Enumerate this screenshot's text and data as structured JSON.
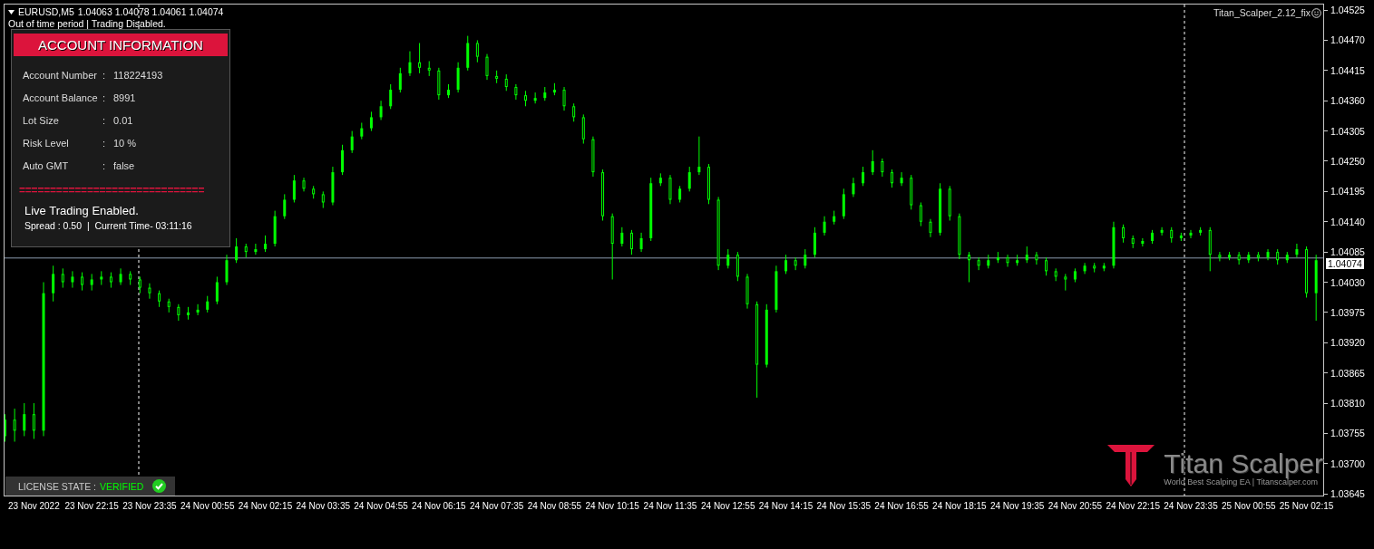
{
  "chart": {
    "symbol": "EURUSD,M5",
    "ohlc": "1.04063 1.04078 1.04061 1.04074",
    "status": "Out of time period | Trading Disabled.",
    "expert": "Titan_Scalper_2.12_fix",
    "current_price": "1.04074"
  },
  "panel": {
    "title": "ACCOUNT INFORMATION",
    "rows": [
      {
        "label": "Account Number",
        "colon": ":",
        "value": "118224193"
      },
      {
        "label": "Account Balance",
        "colon": ":",
        "value": "8991"
      },
      {
        "label": "Lot Size",
        "colon": ":",
        "value": "0.01"
      },
      {
        "label": "Risk Level",
        "colon": ":",
        "value": "10 %"
      },
      {
        "label": "Auto GMT",
        "colon": ":",
        "value": "false"
      }
    ],
    "separator": "==============================",
    "live_status": "Live Trading Enabled.",
    "info_line": "Spread : 0.50  |  Current Time- 03:11:16"
  },
  "license": {
    "label": "LICENSE STATE :",
    "state": "VERIFIED",
    "verified": true
  },
  "logo": {
    "name": "Titan Scalper",
    "tagline": "World Best Scalping EA | Titanscalper.com"
  },
  "chart_data": {
    "type": "candlestick",
    "ylim": [
      1.03642,
      1.04535
    ],
    "ref_lines": [
      {
        "axis": "y",
        "value": 1.04074
      }
    ],
    "yticks": [
      {
        "value": 1.04525,
        "label": "1.04525"
      },
      {
        "value": 1.0447,
        "label": "1.04470"
      },
      {
        "value": 1.04415,
        "label": "1.04415"
      },
      {
        "value": 1.0436,
        "label": "1.04360"
      },
      {
        "value": 1.04305,
        "label": "1.04305"
      },
      {
        "value": 1.0425,
        "label": "1.04250"
      },
      {
        "value": 1.04195,
        "label": "1.04195"
      },
      {
        "value": 1.0414,
        "label": "1.04140"
      },
      {
        "value": 1.04085,
        "label": "1.04085"
      },
      {
        "value": 1.0403,
        "label": "1.04030"
      },
      {
        "value": 1.03975,
        "label": "1.03975"
      },
      {
        "value": 1.0392,
        "label": "1.03920"
      },
      {
        "value": 1.03865,
        "label": "1.03865"
      },
      {
        "value": 1.0381,
        "label": "1.03810"
      },
      {
        "value": 1.03755,
        "label": "1.03755"
      },
      {
        "value": 1.037,
        "label": "1.03700"
      },
      {
        "value": 1.03645,
        "label": "1.03645"
      }
    ],
    "categories": [
      null,
      null,
      null,
      "23 Nov 2022",
      null,
      null,
      null,
      null,
      null,
      "23 Nov 22:15",
      null,
      null,
      null,
      null,
      null,
      "23 Nov 23:35",
      null,
      null,
      null,
      null,
      null,
      "24 Nov 00:55",
      null,
      null,
      null,
      null,
      null,
      "24 Nov 02:15",
      null,
      null,
      null,
      null,
      null,
      "24 Nov 03:35",
      null,
      null,
      null,
      null,
      null,
      "24 Nov 04:55",
      null,
      null,
      null,
      null,
      null,
      "24 Nov 06:15",
      null,
      null,
      null,
      null,
      null,
      "24 Nov 07:35",
      null,
      null,
      null,
      null,
      null,
      "24 Nov 08:55",
      null,
      null,
      null,
      null,
      null,
      "24 Nov 10:15",
      null,
      null,
      null,
      null,
      null,
      "24 Nov 11:35",
      null,
      null,
      null,
      null,
      null,
      "24 Nov 12:55",
      null,
      null,
      null,
      null,
      null,
      "24 Nov 14:15",
      null,
      null,
      null,
      null,
      null,
      "24 Nov 15:35",
      null,
      null,
      null,
      null,
      null,
      "24 Nov 16:55",
      null,
      null,
      null,
      null,
      null,
      "24 Nov 18:15",
      null,
      null,
      null,
      null,
      null,
      "24 Nov 19:35",
      null,
      null,
      null,
      null,
      null,
      "24 Nov 20:55",
      null,
      null,
      null,
      null,
      null,
      "24 Nov 22:15",
      null,
      null,
      null,
      null,
      null,
      "24 Nov 23:35",
      null,
      null,
      null,
      null,
      null,
      "25 Nov 00:55",
      null,
      null,
      null,
      null,
      null,
      "25 Nov 02:15",
      null
    ],
    "ohlc": [
      [
        1.0375,
        1.0379,
        1.0374,
        1.0378
      ],
      [
        1.0378,
        1.038,
        1.0374,
        1.0376
      ],
      [
        1.0376,
        1.0381,
        1.0375,
        1.0379
      ],
      [
        1.0379,
        1.0381,
        1.03745,
        1.0376
      ],
      [
        1.0376,
        1.0403,
        1.0375,
        1.0401
      ],
      [
        1.0401,
        1.0406,
        1.03995,
        1.04045
      ],
      [
        1.04045,
        1.04055,
        1.0402,
        1.0403
      ],
      [
        1.0403,
        1.0405,
        1.0402,
        1.0404
      ],
      [
        1.0404,
        1.04048,
        1.04015,
        1.04025
      ],
      [
        1.04025,
        1.04045,
        1.04015,
        1.04035
      ],
      [
        1.04035,
        1.0405,
        1.04025,
        1.0404
      ],
      [
        1.0404,
        1.04048,
        1.0402,
        1.0403
      ],
      [
        1.0403,
        1.04055,
        1.04025,
        1.04045
      ],
      [
        1.04045,
        1.0405,
        1.04025,
        1.04035
      ],
      [
        1.04035,
        1.0404,
        1.0401,
        1.0402
      ],
      [
        1.0402,
        1.04028,
        1.04,
        1.0401
      ],
      [
        1.0401,
        1.04015,
        1.03985,
        1.03995
      ],
      [
        1.03995,
        1.04,
        1.03975,
        1.03985
      ],
      [
        1.03985,
        1.0399,
        1.0396,
        1.0397
      ],
      [
        1.0397,
        1.03985,
        1.03962,
        1.03975
      ],
      [
        1.03975,
        1.0399,
        1.0397,
        1.0398
      ],
      [
        1.0398,
        1.04005,
        1.03975,
        1.03995
      ],
      [
        1.03995,
        1.0404,
        1.0399,
        1.0403
      ],
      [
        1.0403,
        1.0408,
        1.04025,
        1.0407
      ],
      [
        1.0407,
        1.0411,
        1.04065,
        1.04095
      ],
      [
        1.04095,
        1.041,
        1.04075,
        1.04085
      ],
      [
        1.04085,
        1.041,
        1.0408,
        1.0409
      ],
      [
        1.0409,
        1.04115,
        1.04085,
        1.041
      ],
      [
        1.041,
        1.0416,
        1.04095,
        1.0415
      ],
      [
        1.0415,
        1.0419,
        1.04145,
        1.0418
      ],
      [
        1.0418,
        1.04225,
        1.04175,
        1.04215
      ],
      [
        1.04215,
        1.0422,
        1.04195,
        1.042
      ],
      [
        1.042,
        1.04205,
        1.04182,
        1.0419
      ],
      [
        1.0419,
        1.04195,
        1.04165,
        1.04175
      ],
      [
        1.04175,
        1.0424,
        1.0417,
        1.0423
      ],
      [
        1.0423,
        1.0428,
        1.04225,
        1.0427
      ],
      [
        1.0427,
        1.04305,
        1.04265,
        1.04295
      ],
      [
        1.04295,
        1.0432,
        1.0429,
        1.0431
      ],
      [
        1.0431,
        1.0434,
        1.04305,
        1.0433
      ],
      [
        1.0433,
        1.0436,
        1.04325,
        1.0435
      ],
      [
        1.0435,
        1.0439,
        1.04345,
        1.0438
      ],
      [
        1.0438,
        1.0442,
        1.04375,
        1.0441
      ],
      [
        1.0441,
        1.0445,
        1.04405,
        1.0443
      ],
      [
        1.0443,
        1.04465,
        1.0441,
        1.0442
      ],
      [
        1.0442,
        1.04432,
        1.04405,
        1.04415
      ],
      [
        1.04415,
        1.0442,
        1.04362,
        1.0437
      ],
      [
        1.0437,
        1.0439,
        1.04365,
        1.0438
      ],
      [
        1.0438,
        1.0443,
        1.04375,
        1.0442
      ],
      [
        1.0442,
        1.04478,
        1.04415,
        1.04465
      ],
      [
        1.04465,
        1.0447,
        1.0443,
        1.0444
      ],
      [
        1.0444,
        1.04445,
        1.04398,
        1.04405
      ],
      [
        1.04405,
        1.04415,
        1.04392,
        1.044
      ],
      [
        1.044,
        1.04408,
        1.04378,
        1.04385
      ],
      [
        1.04385,
        1.0439,
        1.04362,
        1.0437
      ],
      [
        1.0437,
        1.04378,
        1.0435,
        1.0436
      ],
      [
        1.0436,
        1.04375,
        1.04355,
        1.04365
      ],
      [
        1.04365,
        1.04385,
        1.0436,
        1.04375
      ],
      [
        1.04375,
        1.04392,
        1.0437,
        1.0438
      ],
      [
        1.0438,
        1.04385,
        1.04342,
        1.0435
      ],
      [
        1.0435,
        1.04355,
        1.04322,
        1.0433
      ],
      [
        1.0433,
        1.04335,
        1.04282,
        1.0429
      ],
      [
        1.0429,
        1.04295,
        1.04222,
        1.0423
      ],
      [
        1.0423,
        1.04235,
        1.04142,
        1.0415
      ],
      [
        1.0415,
        1.04155,
        1.04035,
        1.041
      ],
      [
        1.041,
        1.0413,
        1.04095,
        1.0412
      ],
      [
        1.0412,
        1.04125,
        1.0408,
        1.0409
      ],
      [
        1.0409,
        1.0412,
        1.04085,
        1.0411
      ],
      [
        1.0411,
        1.0422,
        1.04105,
        1.0421
      ],
      [
        1.0421,
        1.04228,
        1.04205,
        1.0422
      ],
      [
        1.0422,
        1.04225,
        1.04172,
        1.0418
      ],
      [
        1.0418,
        1.04205,
        1.04175,
        1.042
      ],
      [
        1.042,
        1.0424,
        1.04195,
        1.0423
      ],
      [
        1.0423,
        1.04295,
        1.04225,
        1.0424
      ],
      [
        1.0424,
        1.04245,
        1.04172,
        1.0418
      ],
      [
        1.0418,
        1.04185,
        1.04052,
        1.0406
      ],
      [
        1.0406,
        1.0409,
        1.04055,
        1.0408
      ],
      [
        1.0408,
        1.04085,
        1.04032,
        1.0404
      ],
      [
        1.0404,
        1.04045,
        1.03982,
        1.0399
      ],
      [
        1.0399,
        1.03995,
        1.0382,
        1.0388
      ],
      [
        1.0388,
        1.0399,
        1.03875,
        1.0398
      ],
      [
        1.0398,
        1.0406,
        1.03975,
        1.0405
      ],
      [
        1.0405,
        1.0408,
        1.04045,
        1.0407
      ],
      [
        1.0407,
        1.04075,
        1.04052,
        1.0406
      ],
      [
        1.0406,
        1.0409,
        1.04055,
        1.0408
      ],
      [
        1.0408,
        1.0413,
        1.04075,
        1.0412
      ],
      [
        1.0412,
        1.0415,
        1.04115,
        1.0414
      ],
      [
        1.0414,
        1.0416,
        1.04135,
        1.0415
      ],
      [
        1.0415,
        1.042,
        1.04145,
        1.0419
      ],
      [
        1.0419,
        1.0422,
        1.04185,
        1.0421
      ],
      [
        1.0421,
        1.0424,
        1.04205,
        1.0423
      ],
      [
        1.0423,
        1.0427,
        1.04225,
        1.0425
      ],
      [
        1.0425,
        1.04255,
        1.04222,
        1.0423
      ],
      [
        1.0423,
        1.04235,
        1.04202,
        1.0421
      ],
      [
        1.0421,
        1.0423,
        1.04205,
        1.0422
      ],
      [
        1.0422,
        1.04225,
        1.04162,
        1.0417
      ],
      [
        1.0417,
        1.04175,
        1.04132,
        1.0414
      ],
      [
        1.0414,
        1.04145,
        1.04112,
        1.0412
      ],
      [
        1.0412,
        1.0421,
        1.04115,
        1.042
      ],
      [
        1.042,
        1.04205,
        1.04142,
        1.0415
      ],
      [
        1.0415,
        1.04155,
        1.04072,
        1.0408
      ],
      [
        1.0408,
        1.04085,
        1.0403,
        1.0407
      ],
      [
        1.0407,
        1.04075,
        1.04052,
        1.0406
      ],
      [
        1.0406,
        1.0408,
        1.04055,
        1.0407
      ],
      [
        1.0407,
        1.04085,
        1.04065,
        1.04075
      ],
      [
        1.04075,
        1.0408,
        1.04058,
        1.04065
      ],
      [
        1.04065,
        1.0408,
        1.0406,
        1.0407
      ],
      [
        1.0407,
        1.04095,
        1.04065,
        1.0408
      ],
      [
        1.0408,
        1.04085,
        1.04062,
        1.0407
      ],
      [
        1.0407,
        1.04075,
        1.04042,
        1.0405
      ],
      [
        1.0405,
        1.04055,
        1.04032,
        1.0404
      ],
      [
        1.0404,
        1.04045,
        1.04015,
        1.04035
      ],
      [
        1.04035,
        1.04055,
        1.0403,
        1.0405
      ],
      [
        1.0405,
        1.04065,
        1.04045,
        1.0406
      ],
      [
        1.0406,
        1.04065,
        1.04048,
        1.04055
      ],
      [
        1.04055,
        1.04065,
        1.0405,
        1.0406
      ],
      [
        1.0406,
        1.0414,
        1.04055,
        1.0413
      ],
      [
        1.0413,
        1.04135,
        1.04102,
        1.0411
      ],
      [
        1.0411,
        1.04115,
        1.04092,
        1.041
      ],
      [
        1.041,
        1.0411,
        1.04095,
        1.04105
      ],
      [
        1.04105,
        1.04125,
        1.041,
        1.0412
      ],
      [
        1.0412,
        1.0413,
        1.04115,
        1.04125
      ],
      [
        1.04125,
        1.0413,
        1.04102,
        1.0411
      ],
      [
        1.0411,
        1.0412,
        1.04105,
        1.04115
      ],
      [
        1.04115,
        1.04125,
        1.0411,
        1.0412
      ],
      [
        1.0412,
        1.0413,
        1.04115,
        1.04125
      ],
      [
        1.04125,
        1.0413,
        1.0405,
        1.0408
      ],
      [
        1.0408,
        1.04085,
        1.04068,
        1.04075
      ],
      [
        1.04075,
        1.04085,
        1.0407,
        1.0408
      ],
      [
        1.0408,
        1.04085,
        1.04062,
        1.0407
      ],
      [
        1.0407,
        1.04085,
        1.04065,
        1.0408
      ],
      [
        1.0408,
        1.04085,
        1.04068,
        1.04075
      ],
      [
        1.04075,
        1.0409,
        1.0407,
        1.04085
      ],
      [
        1.04085,
        1.0409,
        1.04062,
        1.0407
      ],
      [
        1.0407,
        1.04085,
        1.04065,
        1.0408
      ],
      [
        1.0408,
        1.041,
        1.04075,
        1.0409
      ],
      [
        1.0409,
        1.04095,
        1.04002,
        1.0401
      ],
      [
        1.0401,
        1.0408,
        1.0396,
        1.0407
      ]
    ]
  }
}
